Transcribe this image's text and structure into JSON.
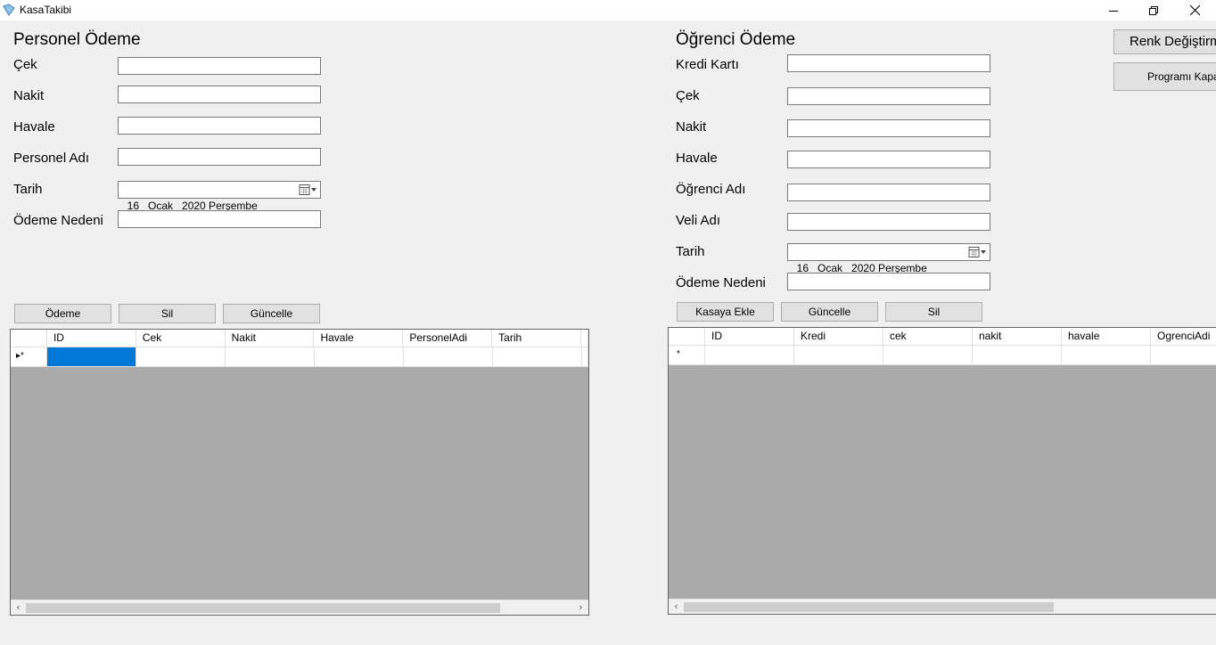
{
  "window": {
    "title": "KasaTakibi"
  },
  "personel": {
    "heading": "Personel Ödeme",
    "labels": {
      "cek": "Çek",
      "nakit": "Nakit",
      "havale": "Havale",
      "personel_adi": "Personel Adı",
      "tarih": "Tarih",
      "odeme_nedeni": "Ödeme Nedeni"
    },
    "date_value": "16   Ocak   2020 Perşembe",
    "buttons": {
      "odeme": "Ödeme",
      "sil": "Sil",
      "guncelle": "Güncelle"
    },
    "grid": {
      "columns": [
        "ID",
        "Cek",
        "Nakit",
        "Havale",
        "PersonelAdi",
        "Tarih"
      ],
      "new_row_marker": "▸*"
    }
  },
  "ogrenci": {
    "heading": "Öğrenci Ödeme",
    "labels": {
      "kredi_karti": "Kredi Kartı",
      "cek": "Çek",
      "nakit": "Nakit",
      "havale": "Havale",
      "ogrenci_adi": "Öğrenci Adı",
      "veli_adi": "Veli Adı",
      "tarih": "Tarih",
      "odeme_nedeni": "Ödeme Nedeni"
    },
    "date_value": "16   Ocak   2020 Perşembe",
    "buttons": {
      "kasaya_ekle": "Kasaya Ekle",
      "guncelle": "Güncelle",
      "sil": "Sil"
    },
    "grid": {
      "columns": [
        "ID",
        "Kredi",
        "cek",
        "nakit",
        "havale",
        "OgrenciAdi"
      ],
      "new_row_marker": "*"
    }
  },
  "side_buttons": {
    "renk_degistir": "Renk Değiştirme",
    "programi_kapat": "Programı Kapat"
  },
  "colors": {
    "selected_cell": "#0078d7",
    "grid_background": "#ababab",
    "form_background": "#f0f0f0"
  }
}
